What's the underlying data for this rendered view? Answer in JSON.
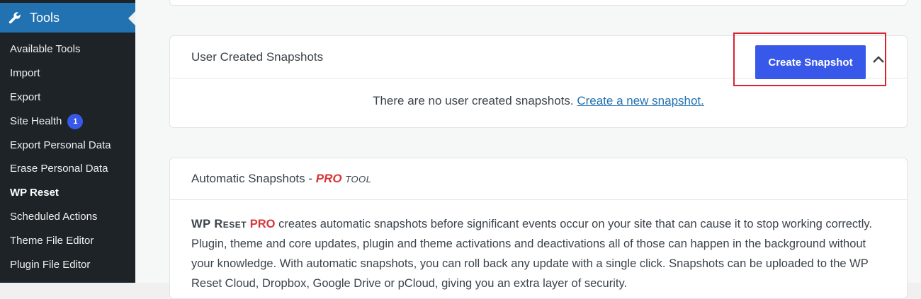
{
  "sidebar": {
    "section_title": "Tools",
    "section_icon": "wrench-icon",
    "items": [
      {
        "label": "Available Tools"
      },
      {
        "label": "Import"
      },
      {
        "label": "Export"
      },
      {
        "label": "Site Health",
        "badge": "1"
      },
      {
        "label": "Export Personal Data"
      },
      {
        "label": "Erase Personal Data"
      },
      {
        "label": "WP Reset",
        "current": true
      },
      {
        "label": "Scheduled Actions"
      },
      {
        "label": "Theme File Editor"
      },
      {
        "label": "Plugin File Editor"
      }
    ]
  },
  "user_snapshots": {
    "title": "User Created Snapshots",
    "create_button": "Create Snapshot",
    "empty_text": "There are no user created snapshots.",
    "empty_link": "Create a new snapshot."
  },
  "auto_snapshots": {
    "title": "Automatic Snapshots - ",
    "pro_label": "PRO",
    "tool_label": "TOOL",
    "brand": "WP Reset",
    "brand_pro": "PRO",
    "description": "creates automatic snapshots before significant events occur on your site that can cause it to stop working correctly. Plugin, theme and core updates, plugin and theme activations and deactivations all of those can happen in the background without your knowledge. With automatic snapshots, you can roll back any update with a single click. Snapshots can be uploaded to the WP Reset Cloud, Dropbox, Google Drive or pCloud, giving you an extra layer of security."
  },
  "colors": {
    "sidebar_bg": "#1d2327",
    "sidebar_active": "#2271b1",
    "button_primary": "#3858e9",
    "pro_red": "#d63638",
    "highlight_red": "#d9232e"
  }
}
